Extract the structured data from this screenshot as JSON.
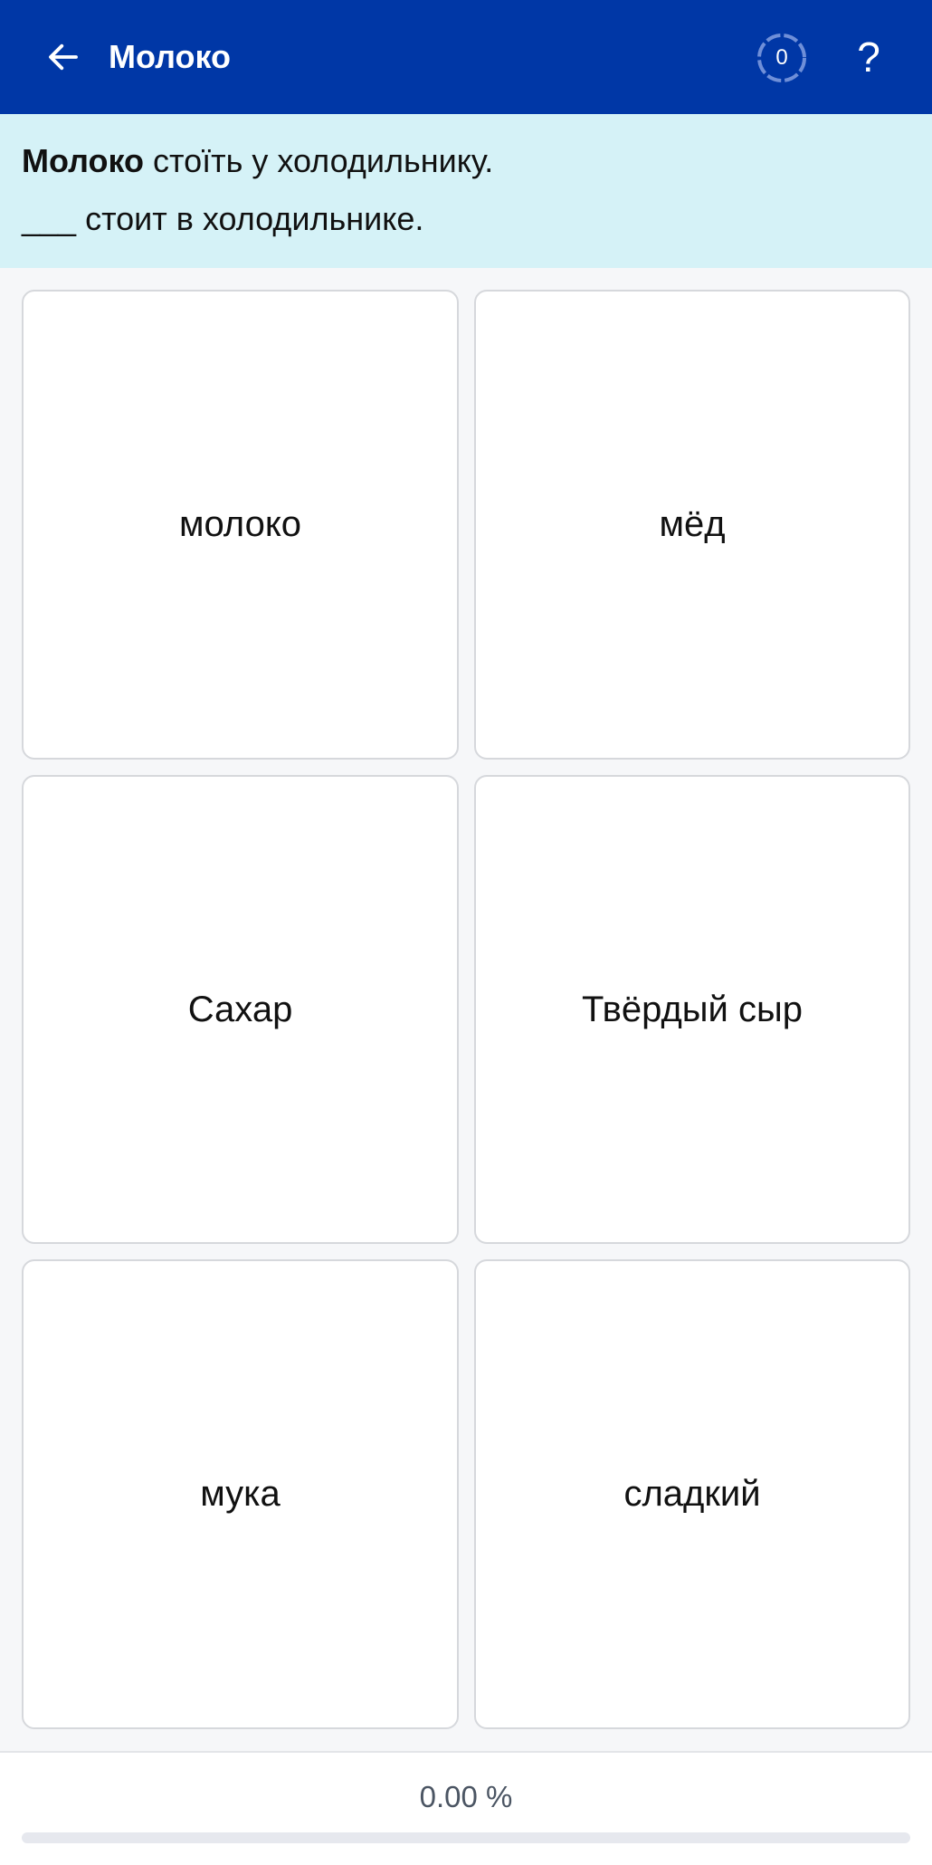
{
  "header": {
    "title": "Молоко",
    "back_icon": "arrow-left-icon",
    "counter_value": "0",
    "help_label": "?"
  },
  "prompt": {
    "source_bold": "Молоко",
    "source_rest": " стоїть у холодильнику.",
    "target_blank": "___",
    "target_rest": " стоит в холодильнике."
  },
  "options": [
    {
      "label": "молоко"
    },
    {
      "label": "мёд"
    },
    {
      "label": "Сахар"
    },
    {
      "label": "Твёрдый сыр"
    },
    {
      "label": "мука"
    },
    {
      "label": "сладкий"
    }
  ],
  "progress": {
    "label": "0.00 %",
    "value": 0
  },
  "colors": {
    "header_bg": "#0037a6",
    "prompt_bg": "#d5f2f7",
    "page_bg": "#f6f7f9"
  }
}
